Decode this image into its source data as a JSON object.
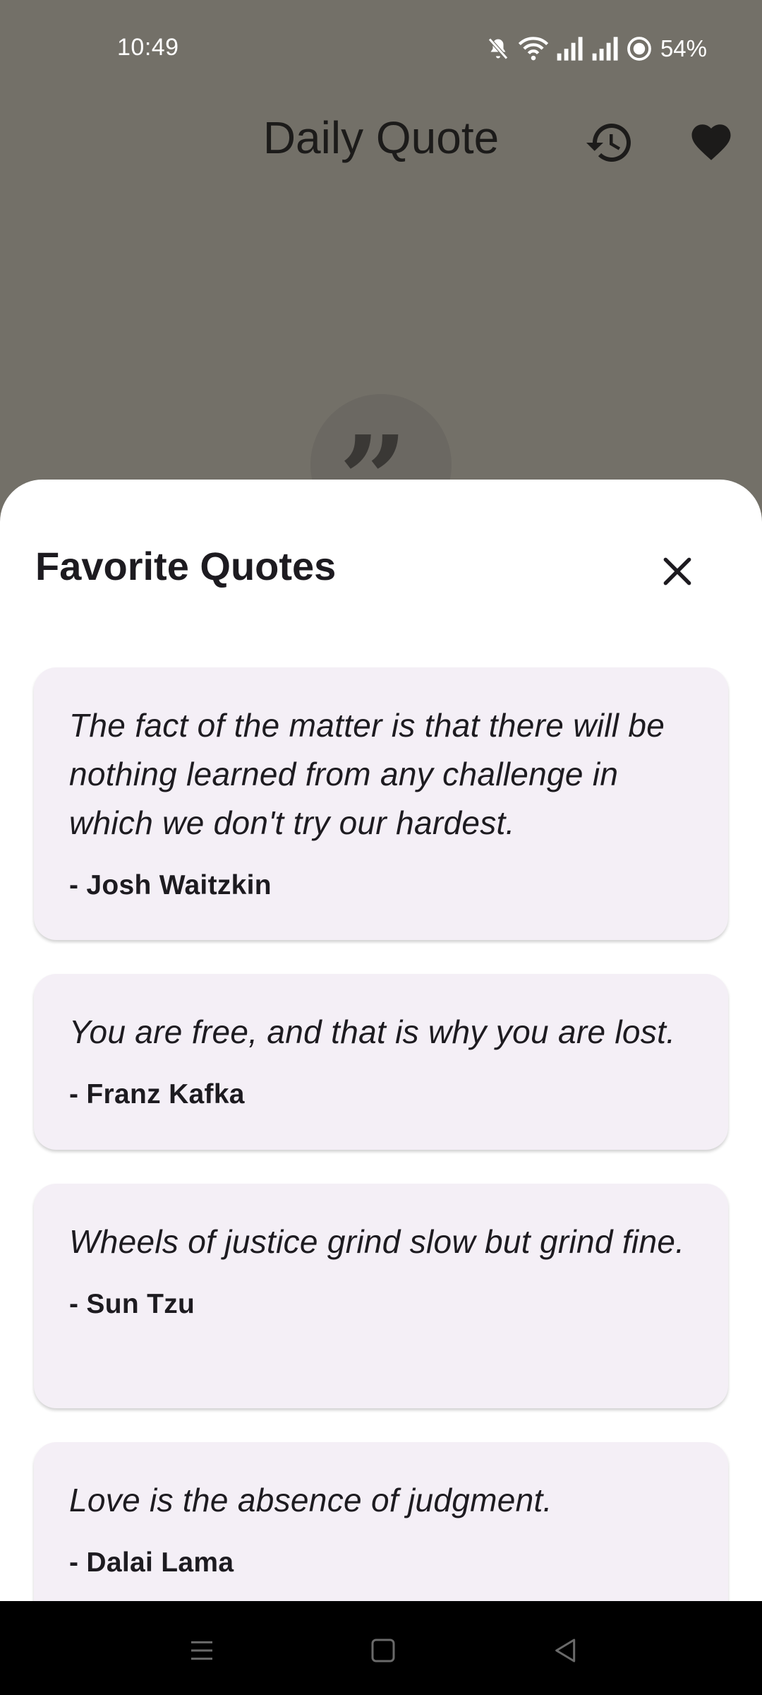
{
  "status_bar": {
    "time": "10:49",
    "battery": "54%",
    "icons": [
      "mute-icon",
      "wifi-icon",
      "signal-icon",
      "signal-icon",
      "battery-icon"
    ]
  },
  "header": {
    "title": "Daily Quote",
    "icons": [
      "history-icon",
      "heart-icon"
    ]
  },
  "background_badge": {
    "glyph": "”"
  },
  "sheet": {
    "title": "Favorite Quotes",
    "close_icon": "close-icon",
    "quotes": [
      {
        "text": "The fact of the matter is that there will be nothing learned from any challenge in which we don't try our hardest.",
        "author": "- Josh Waitzkin"
      },
      {
        "text": "You are free, and that is why you are lost.",
        "author": "- Franz Kafka"
      },
      {
        "text": "Wheels of justice grind slow but grind fine.",
        "author": "- Sun Tzu"
      },
      {
        "text": "Love is the absence of judgment.",
        "author": "- Dalai Lama"
      }
    ]
  },
  "nav_bar": {
    "buttons": [
      "menu-icon",
      "home-icon",
      "back-icon"
    ]
  },
  "colors": {
    "scrim": "#737068",
    "sheet": "#ffffff",
    "card": "#f4eff6",
    "text": "#1d1b20"
  }
}
